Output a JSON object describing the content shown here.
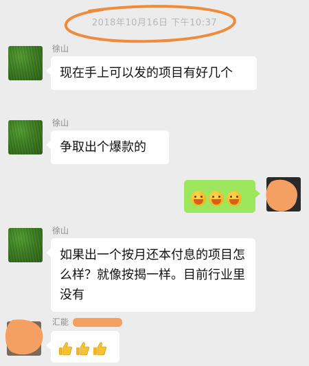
{
  "chat": {
    "timestamp": "2018年10月16日 下午10:37",
    "messages": [
      {
        "sender": "徐山",
        "text": "现在手上可以发的项目有好几个"
      },
      {
        "sender": "徐山",
        "text": "争取出个爆款的"
      },
      {
        "from": "self",
        "emoji": [
          "smile-emoji",
          "smile-emoji",
          "smile-emoji"
        ]
      },
      {
        "sender": "徐山",
        "text": "如果出一个按月还本付息的项目怎么样？就像按揭一样。目前行业里没有"
      },
      {
        "sender": "汇能",
        "emoji": [
          "thumbs-up-icon",
          "thumbs-up-icon",
          "thumbs-up-icon"
        ]
      }
    ]
  },
  "colors": {
    "background": "#ececec",
    "bubble_left": "#ffffff",
    "bubble_right": "#9de75e",
    "highlight_scribble": "#f08a3c",
    "redaction": "#f4a062"
  }
}
